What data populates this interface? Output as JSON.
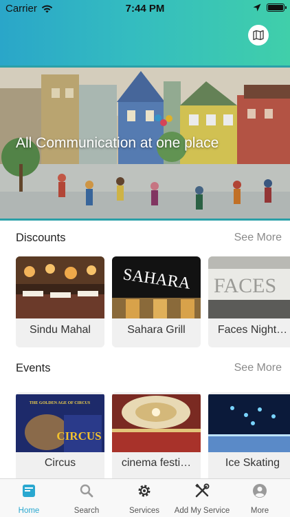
{
  "status_bar": {
    "carrier": "Carrier",
    "time": "7:44 PM"
  },
  "header": {
    "map_icon": "map-icon"
  },
  "banner": {
    "caption": "All Communication at one place"
  },
  "discounts": {
    "title": "Discounts",
    "see_more": "See More",
    "items": [
      {
        "name": "Sindu Mahal"
      },
      {
        "name": "Sahara Grill",
        "sign_text": "SAHARA"
      },
      {
        "name": "Faces Night…",
        "sign_text": "FACES"
      }
    ]
  },
  "events": {
    "title": "Events",
    "see_more": "See More",
    "items": [
      {
        "name": "Circus",
        "poster_text": "THE GOLDEN AGE OF CIRCUS",
        "poster_title": "CIRCUS"
      },
      {
        "name": "cinema festi…"
      },
      {
        "name": "Ice Skating"
      }
    ]
  },
  "tabbar": {
    "items": [
      {
        "label": "Home",
        "icon": "home-icon",
        "active": true
      },
      {
        "label": "Search",
        "icon": "search-icon"
      },
      {
        "label": "Services",
        "icon": "gear-icon"
      },
      {
        "label": "Add My Service",
        "icon": "tools-icon"
      },
      {
        "label": "More",
        "icon": "profile-icon"
      }
    ]
  },
  "colors": {
    "accent": "#2aa8d0",
    "header_start": "#2aa6c9",
    "header_end": "#40cfaa"
  }
}
